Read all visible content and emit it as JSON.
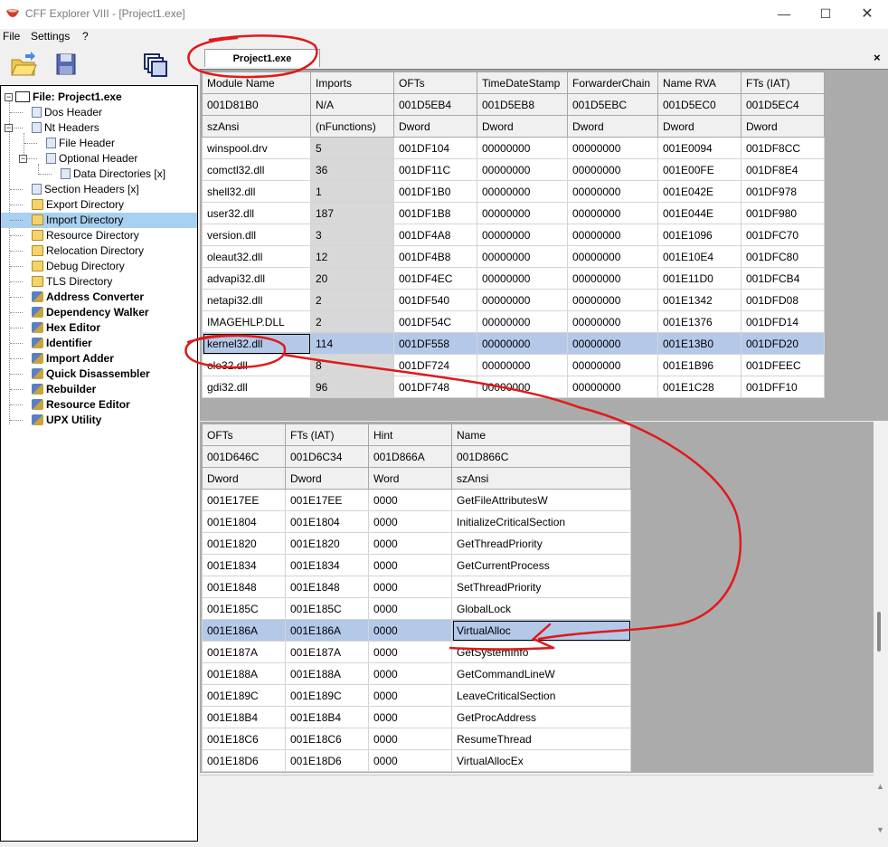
{
  "window": {
    "title": "CFF Explorer VIII - [Project1.exe]",
    "app_icon": "cff-explorer-icon"
  },
  "menu": [
    "File",
    "Settings",
    "?"
  ],
  "tab": {
    "label": "Project1.exe",
    "close": "×"
  },
  "tree": {
    "root": "File: Project1.exe",
    "items": [
      {
        "label": "Dos Header",
        "icon": "doc-icon",
        "bold": false
      },
      {
        "label": "Nt Headers",
        "icon": "doc-icon",
        "bold": false
      },
      {
        "label": "File Header",
        "icon": "doc-icon",
        "bold": false
      },
      {
        "label": "Optional Header",
        "icon": "doc-icon",
        "bold": false
      },
      {
        "label": "Data Directories [x]",
        "icon": "doc-icon",
        "bold": false
      },
      {
        "label": "Section Headers [x]",
        "icon": "doc-icon",
        "bold": false
      },
      {
        "label": "Export Directory",
        "icon": "folder-icon",
        "bold": false
      },
      {
        "label": "Import Directory",
        "icon": "folder-icon",
        "bold": false,
        "selected": true
      },
      {
        "label": "Resource Directory",
        "icon": "folder-icon",
        "bold": false
      },
      {
        "label": "Relocation Directory",
        "icon": "folder-icon",
        "bold": false
      },
      {
        "label": "Debug Directory",
        "icon": "folder-icon",
        "bold": false
      },
      {
        "label": "TLS Directory",
        "icon": "folder-icon",
        "bold": false
      },
      {
        "label": "Address Converter",
        "icon": "tool-icon",
        "bold": true
      },
      {
        "label": "Dependency Walker",
        "icon": "tool-icon",
        "bold": true
      },
      {
        "label": "Hex Editor",
        "icon": "tool-icon",
        "bold": true
      },
      {
        "label": "Identifier",
        "icon": "tool-icon",
        "bold": true
      },
      {
        "label": "Import Adder",
        "icon": "tool-icon",
        "bold": true
      },
      {
        "label": "Quick Disassembler",
        "icon": "tool-icon",
        "bold": true
      },
      {
        "label": "Rebuilder",
        "icon": "tool-icon",
        "bold": true
      },
      {
        "label": "Resource Editor",
        "icon": "tool-icon",
        "bold": true
      },
      {
        "label": "UPX Utility",
        "icon": "tool-icon",
        "bold": true
      }
    ]
  },
  "modules": {
    "headers": [
      "Module Name",
      "Imports",
      "OFTs",
      "TimeDateStamp",
      "ForwarderChain",
      "Name RVA",
      "FTs (IAT)"
    ],
    "offsets": [
      "001D81B0",
      "N/A",
      "001D5EB4",
      "001D5EB8",
      "001D5EBC",
      "001D5EC0",
      "001D5EC4"
    ],
    "types": [
      "szAnsi",
      "(nFunctions)",
      "Dword",
      "Dword",
      "Dword",
      "Dword",
      "Dword"
    ],
    "rows": [
      [
        "winspool.drv",
        "5",
        "001DF104",
        "00000000",
        "00000000",
        "001E0094",
        "001DF8CC"
      ],
      [
        "comctl32.dll",
        "36",
        "001DF11C",
        "00000000",
        "00000000",
        "001E00FE",
        "001DF8E4"
      ],
      [
        "shell32.dll",
        "1",
        "001DF1B0",
        "00000000",
        "00000000",
        "001E042E",
        "001DF978"
      ],
      [
        "user32.dll",
        "187",
        "001DF1B8",
        "00000000",
        "00000000",
        "001E044E",
        "001DF980"
      ],
      [
        "version.dll",
        "3",
        "001DF4A8",
        "00000000",
        "00000000",
        "001E1096",
        "001DFC70"
      ],
      [
        "oleaut32.dll",
        "12",
        "001DF4B8",
        "00000000",
        "00000000",
        "001E10E4",
        "001DFC80"
      ],
      [
        "advapi32.dll",
        "20",
        "001DF4EC",
        "00000000",
        "00000000",
        "001E11D0",
        "001DFCB4"
      ],
      [
        "netapi32.dll",
        "2",
        "001DF540",
        "00000000",
        "00000000",
        "001E1342",
        "001DFD08"
      ],
      [
        "IMAGEHLP.DLL",
        "2",
        "001DF54C",
        "00000000",
        "00000000",
        "001E1376",
        "001DFD14"
      ],
      [
        "kernel32.dll",
        "114",
        "001DF558",
        "00000000",
        "00000000",
        "001E13B0",
        "001DFD20"
      ],
      [
        "ole32.dll",
        "8",
        "001DF724",
        "00000000",
        "00000000",
        "001E1B96",
        "001DFEEC"
      ],
      [
        "gdi32.dll",
        "96",
        "001DF748",
        "00000000",
        "00000000",
        "001E1C28",
        "001DFF10"
      ]
    ],
    "selected_row": 9
  },
  "functions": {
    "headers": [
      "OFTs",
      "FTs (IAT)",
      "Hint",
      "Name"
    ],
    "offsets": [
      "001D646C",
      "001D6C34",
      "001D866A",
      "001D866C"
    ],
    "types": [
      "Dword",
      "Dword",
      "Word",
      "szAnsi"
    ],
    "rows": [
      [
        "001E17EE",
        "001E17EE",
        "0000",
        "GetFileAttributesW"
      ],
      [
        "001E1804",
        "001E1804",
        "0000",
        "InitializeCriticalSection"
      ],
      [
        "001E1820",
        "001E1820",
        "0000",
        "GetThreadPriority"
      ],
      [
        "001E1834",
        "001E1834",
        "0000",
        "GetCurrentProcess"
      ],
      [
        "001E1848",
        "001E1848",
        "0000",
        "SetThreadPriority"
      ],
      [
        "001E185C",
        "001E185C",
        "0000",
        "GlobalLock"
      ],
      [
        "001E186A",
        "001E186A",
        "0000",
        "VirtualAlloc"
      ],
      [
        "001E187A",
        "001E187A",
        "0000",
        "GetSystemInfo"
      ],
      [
        "001E188A",
        "001E188A",
        "0000",
        "GetCommandLineW"
      ],
      [
        "001E189C",
        "001E189C",
        "0000",
        "LeaveCriticalSection"
      ],
      [
        "001E18B4",
        "001E18B4",
        "0000",
        "GetProcAddress"
      ],
      [
        "001E18C6",
        "001E18C6",
        "0000",
        "ResumeThread"
      ],
      [
        "001E18D6",
        "001E18D6",
        "0000",
        "VirtualAllocEx"
      ]
    ],
    "selected_row": 6
  },
  "colors": {
    "selection": "#b4c9e8",
    "annotation": "#e0191b",
    "tree_selection": "#a8d0f0"
  }
}
